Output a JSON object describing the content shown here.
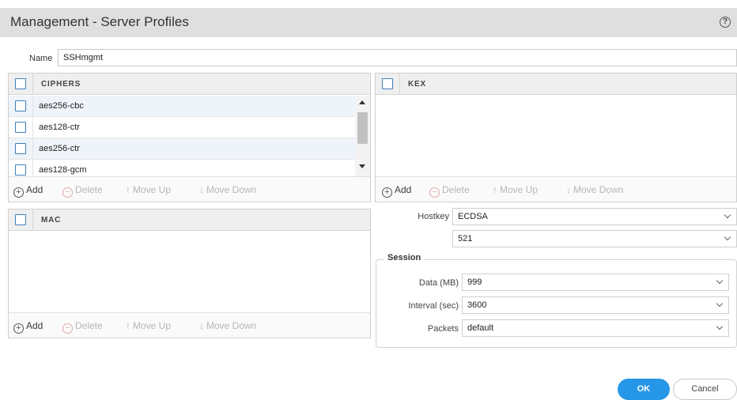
{
  "window": {
    "title": "Management - Server Profiles",
    "help_icon": "?"
  },
  "name_field": {
    "label": "Name",
    "value": "SSHmgmt"
  },
  "ciphers": {
    "header": "CIPHERS",
    "rows": [
      "aes256-cbc",
      "aes128-ctr",
      "aes256-ctr",
      "aes128-gcm"
    ]
  },
  "kex": {
    "header": "KEX",
    "rows": []
  },
  "mac": {
    "header": "MAC",
    "rows": []
  },
  "toolbar": {
    "add": "Add",
    "delete": "Delete",
    "move_up": "Move Up",
    "move_down": "Move Down"
  },
  "hostkey": {
    "label": "Hostkey",
    "type_value": "ECDSA",
    "bits_value": "521"
  },
  "session": {
    "legend": "Session",
    "data": {
      "label": "Data (MB)",
      "value": "999"
    },
    "interval": {
      "label": "Interval (sec)",
      "value": "3600"
    },
    "packets": {
      "label": "Packets",
      "value": "default"
    }
  },
  "buttons": {
    "ok": "OK",
    "cancel": "Cancel"
  },
  "colors": {
    "accent": "#2596e8",
    "header_bg": "#dfdfdf",
    "row_alt": "#eef4f9",
    "checkbox": "#3f7fb8"
  }
}
